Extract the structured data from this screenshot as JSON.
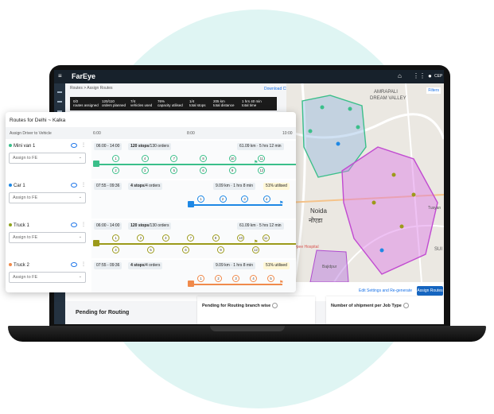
{
  "app": {
    "brand": "FarEye",
    "user": "CEP"
  },
  "header": {
    "breadcrumb": "Routes > Assign Routes",
    "download": "Download CSV"
  },
  "stats": [
    {
      "value": "0/2",
      "label": "routes assigned"
    },
    {
      "value": "120/110",
      "label": "orders planned"
    },
    {
      "value": "7/4",
      "label": "vehicles used"
    },
    {
      "value": "76%",
      "label": "capacity utilised"
    },
    {
      "value": "1/4",
      "label": "total stops"
    },
    {
      "value": "205 km",
      "label": "total distance"
    },
    {
      "value": "1 hrs 40 min",
      "label": "total time"
    }
  ],
  "map": {
    "filters": "Filters",
    "labels": [
      "AMRAPALI",
      "DREAM VALLEY",
      "Noida",
      "नोएडा",
      "Jaypee Hospital",
      "Bajidpur",
      "Tusyan",
      "SUI"
    ]
  },
  "panel": {
    "title": "Routes for Delhi ~ Kalka",
    "assign_label": "Assign Driver to Vehicle",
    "times": [
      "6:00",
      "8:00",
      "10:00"
    ],
    "select_placeholder": "Assign to FE",
    "vehicles": [
      {
        "name": "Mini van 1",
        "color": "#3bbf8a",
        "time": "06:00 - 14:00",
        "stops": "120 stops",
        "orders": "/130 orders",
        "km": "61.09 km",
        "dur": "5 hrs 12 min",
        "util": "",
        "track": "#3bbf8a",
        "stops_top": [
          "1",
          "4",
          "7",
          "8",
          "10",
          "11"
        ],
        "stops_bot": [
          "2",
          "3",
          "5",
          "6",
          "9",
          "12"
        ]
      },
      {
        "name": "Car 1",
        "color": "#1e88e5",
        "time": "07:55 - 09:36",
        "stops": "4 stops",
        "orders": "/4 orders",
        "km": "9.09 km",
        "dur": "1 hrs 8 min",
        "util": "51% utilised",
        "track": "#1e88e5",
        "stops_top": [
          "1",
          "2",
          "3",
          "4"
        ],
        "stops_bot": []
      },
      {
        "name": "Truck 1",
        "color": "#8fa31d",
        "time": "06:00 - 14:00",
        "stops": "120 stops",
        "orders": "/130 orders",
        "km": "61.09 km",
        "dur": "5 hrs 12 min",
        "util": "",
        "track": "#9c9a1a",
        "stops_top": [
          "1",
          "2",
          "3",
          "7",
          "8",
          "10",
          "11"
        ],
        "stops_bot": [
          "4",
          "5",
          "6",
          "9",
          "12"
        ]
      },
      {
        "name": "Truck 2",
        "color": "#f08a4b",
        "time": "07:55 - 09:36",
        "stops": "4 stops",
        "orders": "/4 orders",
        "km": "9.09 km",
        "dur": "1 hrs 8 min",
        "util": "51% utilised",
        "track": "#f08a4b",
        "stops_top": [
          "1",
          "2",
          "3",
          "4",
          "5"
        ],
        "stops_bot": []
      }
    ]
  },
  "footer": {
    "edit_link": "Edit Settings and Re-generate",
    "assign_button": "Assign Routes"
  },
  "bottom": {
    "pending_title": "Pending for Routing",
    "card1": "Pending for Routing branch wise",
    "card2": "Number of shipment per Job Type"
  }
}
